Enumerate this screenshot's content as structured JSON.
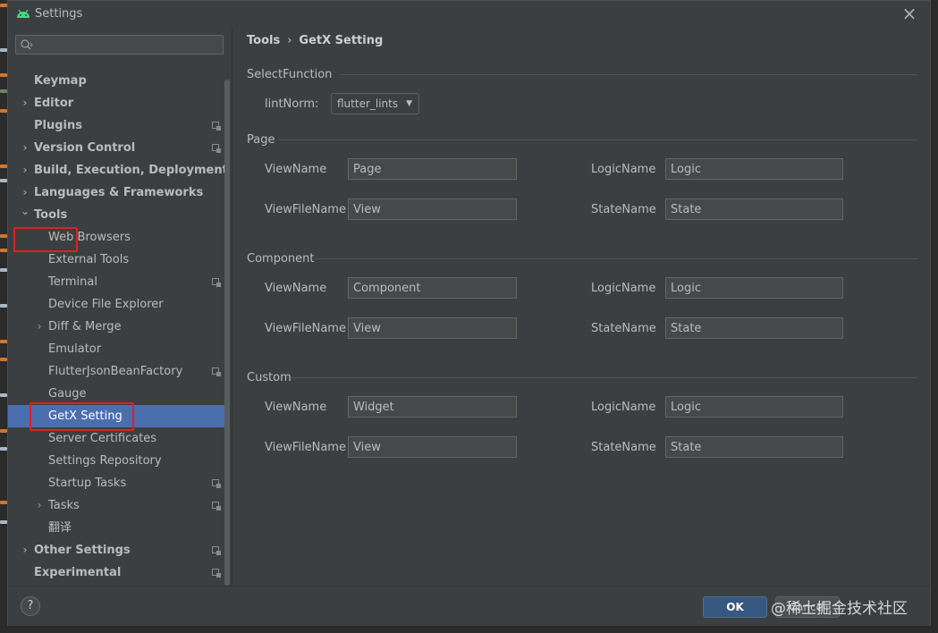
{
  "window": {
    "title": "Settings"
  },
  "search": {
    "value": "",
    "placeholder": ""
  },
  "sidebar": {
    "items": [
      {
        "label": "Keymap",
        "bold": true,
        "level": 0,
        "arrow": "",
        "proj": false
      },
      {
        "label": "Editor",
        "bold": true,
        "level": 0,
        "arrow": "right",
        "proj": false
      },
      {
        "label": "Plugins",
        "bold": true,
        "level": 0,
        "arrow": "",
        "proj": true
      },
      {
        "label": "Version Control",
        "bold": true,
        "level": 0,
        "arrow": "right",
        "proj": true
      },
      {
        "label": "Build, Execution, Deployment",
        "bold": true,
        "level": 0,
        "arrow": "right",
        "proj": false
      },
      {
        "label": "Languages & Frameworks",
        "bold": true,
        "level": 0,
        "arrow": "right",
        "proj": false
      },
      {
        "label": "Tools",
        "bold": true,
        "level": 0,
        "arrow": "down",
        "proj": false
      },
      {
        "label": "Web Browsers",
        "bold": false,
        "level": 1,
        "arrow": "",
        "proj": false
      },
      {
        "label": "External Tools",
        "bold": false,
        "level": 1,
        "arrow": "",
        "proj": false
      },
      {
        "label": "Terminal",
        "bold": false,
        "level": 1,
        "arrow": "",
        "proj": true
      },
      {
        "label": "Device File Explorer",
        "bold": false,
        "level": 1,
        "arrow": "",
        "proj": false
      },
      {
        "label": "Diff & Merge",
        "bold": false,
        "level": 1,
        "arrow": "right",
        "proj": false
      },
      {
        "label": "Emulator",
        "bold": false,
        "level": 1,
        "arrow": "",
        "proj": false
      },
      {
        "label": "FlutterJsonBeanFactory",
        "bold": false,
        "level": 1,
        "arrow": "",
        "proj": true
      },
      {
        "label": "Gauge",
        "bold": false,
        "level": 1,
        "arrow": "",
        "proj": false
      },
      {
        "label": "GetX Setting",
        "bold": false,
        "level": 1,
        "arrow": "",
        "proj": false,
        "selected": true
      },
      {
        "label": "Server Certificates",
        "bold": false,
        "level": 1,
        "arrow": "",
        "proj": false
      },
      {
        "label": "Settings Repository",
        "bold": false,
        "level": 1,
        "arrow": "",
        "proj": false
      },
      {
        "label": "Startup Tasks",
        "bold": false,
        "level": 1,
        "arrow": "",
        "proj": true
      },
      {
        "label": "Tasks",
        "bold": false,
        "level": 1,
        "arrow": "right",
        "proj": true
      },
      {
        "label": "翻译",
        "bold": false,
        "level": 1,
        "arrow": "",
        "proj": false
      },
      {
        "label": "Other Settings",
        "bold": true,
        "level": 0,
        "arrow": "right",
        "proj": true
      },
      {
        "label": "Experimental",
        "bold": true,
        "level": 0,
        "arrow": "",
        "proj": true
      }
    ]
  },
  "breadcrumb": {
    "parent": "Tools",
    "sep": "›",
    "current": "GetX Setting"
  },
  "selectFunction": {
    "title": "SelectFunction",
    "lint_label": "lintNorm:",
    "lint_value": "flutter_lints"
  },
  "labels": {
    "viewName": "ViewName",
    "viewFileName": "ViewFileName",
    "logicName": "LogicName",
    "stateName": "StateName"
  },
  "sections": [
    {
      "title": "Page",
      "viewName": "Page",
      "viewFileName": "View",
      "logicName": "Logic",
      "stateName": "State"
    },
    {
      "title": "Component",
      "viewName": "Component",
      "viewFileName": "View",
      "logicName": "Logic",
      "stateName": "State"
    },
    {
      "title": "Custom",
      "viewName": "Widget",
      "viewFileName": "View",
      "logicName": "Logic",
      "stateName": "State"
    }
  ],
  "footer": {
    "help": "?",
    "ok": "OK",
    "cancel": "Cancel"
  },
  "watermark": "@稀土掘金技术社区",
  "colors": {
    "selection": "#4b6eaf",
    "highlight": "#e02020",
    "ok_button": "#365880",
    "background": "#3c3f41"
  }
}
